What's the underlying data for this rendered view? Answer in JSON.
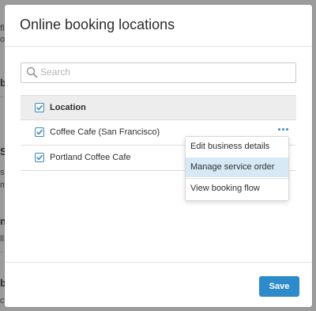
{
  "modal": {
    "title": "Online booking locations"
  },
  "search": {
    "placeholder": "Search"
  },
  "table": {
    "header_label": "Location",
    "rows": [
      {
        "label": "Coffee Cafe (San Francisco)",
        "checked": true
      },
      {
        "label": "Portland Coffee Cafe",
        "checked": true
      }
    ]
  },
  "dropdown": {
    "items": [
      {
        "label": "Edit business details"
      },
      {
        "label": "Manage service order"
      },
      {
        "label": "View booking flow"
      }
    ],
    "highlighted_item": "Manage service order"
  },
  "footer": {
    "save_label": "Save"
  },
  "background": {
    "fragments": [
      "fl",
      "o",
      "b",
      "S",
      "s",
      "m",
      "n",
      "ll",
      "b",
      "c"
    ]
  },
  "colors": {
    "accent": "#2e8bcb",
    "checkbox": "#3c87c0",
    "menu_highlight": "#d6e9f5",
    "overlay": "#9b9b9b"
  },
  "icons": {
    "search": "search-icon",
    "more": "more-horizontal-icon",
    "checkbox": "checkmark-icon"
  }
}
